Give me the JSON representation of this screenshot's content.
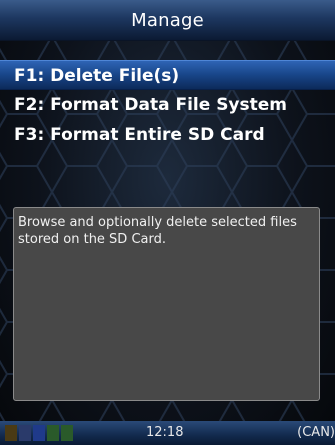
{
  "header": {
    "title": "Manage"
  },
  "menu": {
    "items": [
      {
        "label": "F1: Delete File(s)",
        "selected": true
      },
      {
        "label": "F2: Format Data File System",
        "selected": false
      },
      {
        "label": "F3: Format Entire SD Card",
        "selected": false
      }
    ]
  },
  "description": {
    "text": "Browse and optionally delete selected files stored on the SD Card."
  },
  "status_bar": {
    "time": "12:18",
    "bus": "(CAN)",
    "indicator_colors": [
      "#4a3a14",
      "#2a3a6a",
      "#1f3a8a",
      "#2a5a2a",
      "#2a5a2a"
    ]
  },
  "colors": {
    "selection": "#184588",
    "panel": "#484848",
    "title_bar": "#1d3760"
  }
}
